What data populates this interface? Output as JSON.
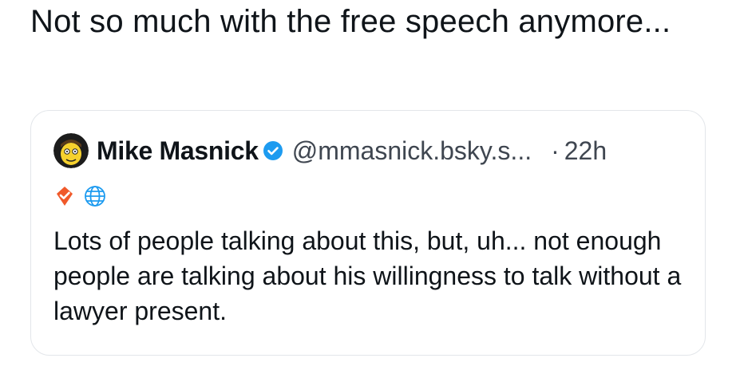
{
  "post": {
    "text": "Not so much with the free speech anymore..."
  },
  "quote": {
    "author_name": "Mike Masnick",
    "handle": "@mmasnick.bsky.s...",
    "separator": "·",
    "timestamp": "22h",
    "body": "Lots of people talking about this, but, uh... not enough people are talking about his willingness to talk without a lawyer present.",
    "icons": {
      "verified": "verified-check-icon",
      "badge": "orange-shield-check-icon",
      "link": "globe-icon"
    },
    "colors": {
      "verified_blue": "#1d9bf0",
      "badge_orange": "#f0592a",
      "globe_blue": "#1d9bf0"
    }
  }
}
